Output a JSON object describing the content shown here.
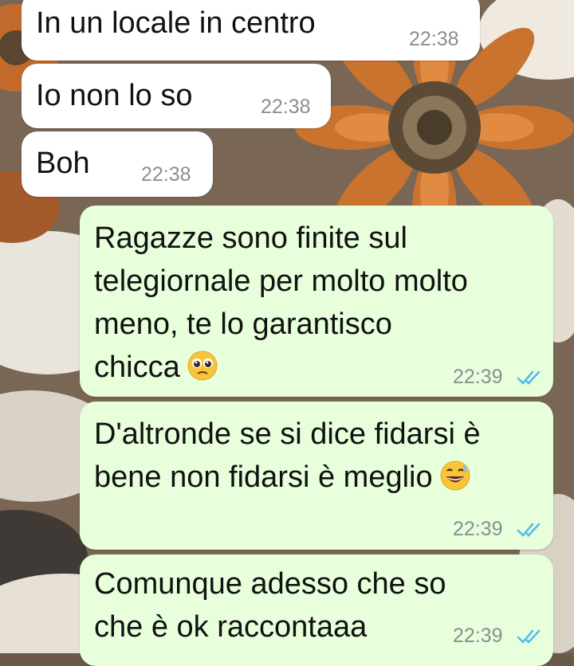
{
  "messages": [
    {
      "direction": "incoming",
      "text": "In un locale in centro",
      "time": "22:38"
    },
    {
      "direction": "incoming",
      "text": "Io non lo so",
      "time": "22:38"
    },
    {
      "direction": "incoming",
      "text": "Boh",
      "time": "22:38"
    },
    {
      "direction": "outgoing",
      "text": "Ragazze sono finite sul\ntelegiornale per molto molto\nmeno, te lo garantisco\nchicca",
      "emoji": "pleading-face",
      "time": "22:39",
      "status": "read"
    },
    {
      "direction": "outgoing",
      "text": "D'altronde se si dice fidarsi è\nbene non fidarsi è meglio",
      "emoji": "grinning-sweat-face",
      "time": "22:39",
      "status": "read"
    },
    {
      "direction": "outgoing",
      "text": "Comunque adesso che so\nche è ok raccontaaa",
      "time": "22:39",
      "status": "read"
    }
  ],
  "colors": {
    "incoming_bubble": "#ffffff",
    "outgoing_bubble": "#e7ffdb",
    "timestamp": "#8a8f93",
    "read_ticks": "#53bdeb"
  }
}
